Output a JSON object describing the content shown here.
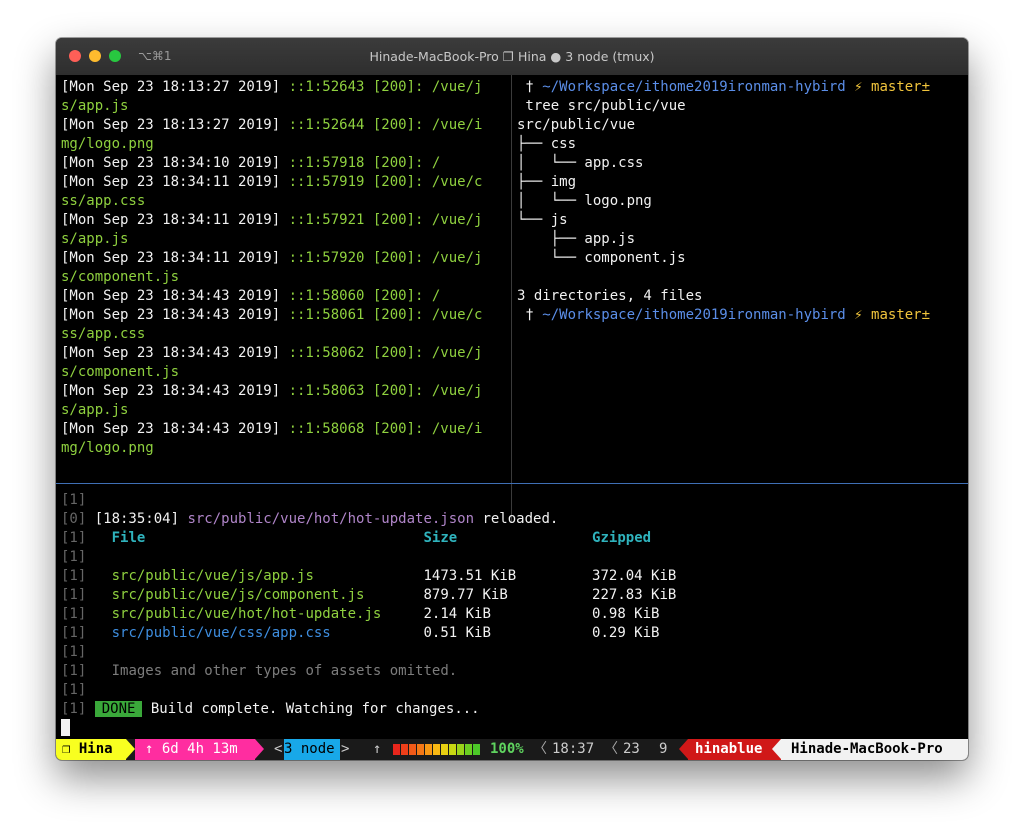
{
  "window": {
    "shortcut": "⌥⌘1",
    "title": "Hinade-MacBook-Pro ❐ Hina ● 3 node (tmux)"
  },
  "left_pane": {
    "lines": [
      [
        [
          "[Mon Sep 23 18:13:27 2019] ",
          "white"
        ],
        [
          "::1:52643 [200]: /vue/j",
          "green"
        ]
      ],
      [
        [
          "s/app.js",
          "green"
        ]
      ],
      [
        [
          "[Mon Sep 23 18:13:27 2019] ",
          "white"
        ],
        [
          "::1:52644 [200]: /vue/i",
          "green"
        ]
      ],
      [
        [
          "mg/logo.png",
          "green"
        ]
      ],
      [
        [
          "[Mon Sep 23 18:34:10 2019] ",
          "white"
        ],
        [
          "::1:57918 [200]: /",
          "green"
        ]
      ],
      [
        [
          "[Mon Sep 23 18:34:11 2019] ",
          "white"
        ],
        [
          "::1:57919 [200]: /vue/c",
          "green"
        ]
      ],
      [
        [
          "ss/app.css",
          "green"
        ]
      ],
      [
        [
          "[Mon Sep 23 18:34:11 2019] ",
          "white"
        ],
        [
          "::1:57921 [200]: /vue/j",
          "green"
        ]
      ],
      [
        [
          "s/app.js",
          "green"
        ]
      ],
      [
        [
          "[Mon Sep 23 18:34:11 2019] ",
          "white"
        ],
        [
          "::1:57920 [200]: /vue/j",
          "green"
        ]
      ],
      [
        [
          "s/component.js",
          "green"
        ]
      ],
      [
        [
          "[Mon Sep 23 18:34:43 2019] ",
          "white"
        ],
        [
          "::1:58060 [200]: /",
          "green"
        ]
      ],
      [
        [
          "[Mon Sep 23 18:34:43 2019] ",
          "white"
        ],
        [
          "::1:58061 [200]: /vue/c",
          "green"
        ]
      ],
      [
        [
          "ss/app.css",
          "green"
        ]
      ],
      [
        [
          "[Mon Sep 23 18:34:43 2019] ",
          "white"
        ],
        [
          "::1:58062 [200]: /vue/j",
          "green"
        ]
      ],
      [
        [
          "s/component.js",
          "green"
        ]
      ],
      [
        [
          "[Mon Sep 23 18:34:43 2019] ",
          "white"
        ],
        [
          "::1:58063 [200]: /vue/j",
          "green"
        ]
      ],
      [
        [
          "s/app.js",
          "green"
        ]
      ],
      [
        [
          "[Mon Sep 23 18:34:43 2019] ",
          "white"
        ],
        [
          "::1:58068 [200]: /vue/i",
          "green"
        ]
      ],
      [
        [
          "mg/logo.png",
          "green"
        ]
      ]
    ]
  },
  "right_pane": {
    "lines": [
      [
        [
          " † ",
          "white"
        ],
        [
          "~/Workspace/ithome2019ironman-hybird ",
          "blue"
        ],
        [
          "⚡ master±",
          "yellow"
        ]
      ],
      [
        [
          " tree src/public/vue",
          "white"
        ]
      ],
      [
        [
          "src/public/vue",
          "white"
        ]
      ],
      [
        [
          "├── css",
          "white"
        ]
      ],
      [
        [
          "│   └── app.css",
          "white"
        ]
      ],
      [
        [
          "├── img",
          "white"
        ]
      ],
      [
        [
          "│   └── logo.png",
          "white"
        ]
      ],
      [
        [
          "└── js",
          "white"
        ]
      ],
      [
        [
          "    ├── app.js",
          "white"
        ]
      ],
      [
        [
          "    └── component.js",
          "white"
        ]
      ],
      [
        [
          "",
          "white"
        ]
      ],
      [
        [
          "3 directories, 4 files",
          "white"
        ]
      ],
      [
        [
          " † ",
          "white"
        ],
        [
          "~/Workspace/ithome2019ironman-hybird ",
          "blue"
        ],
        [
          "⚡ master±",
          "yellow"
        ]
      ]
    ]
  },
  "bottom_pane": {
    "lines": [
      [
        [
          "[1]",
          "gray"
        ]
      ],
      [
        [
          "[0] ",
          "gray"
        ],
        [
          "[18:35:04] ",
          "white"
        ],
        [
          "src/public/vue/hot/hot-update.json",
          "purple"
        ],
        [
          " reloaded.",
          "white"
        ]
      ],
      [
        [
          "[1]",
          "gray"
        ],
        [
          "   ",
          "white"
        ],
        [
          "File                                 ",
          "cyan"
        ],
        [
          "Size                ",
          "cyan"
        ],
        [
          "Gzipped",
          "cyan"
        ]
      ],
      [
        [
          "[1]",
          "gray"
        ]
      ],
      [
        [
          "[1]",
          "gray"
        ],
        [
          "   ",
          "white"
        ],
        [
          "src/public/vue/js/app.js",
          "green"
        ],
        [
          "             1473.51 KiB         372.04 KiB",
          "white"
        ]
      ],
      [
        [
          "[1]",
          "gray"
        ],
        [
          "   ",
          "white"
        ],
        [
          "src/public/vue/js/component.js",
          "green"
        ],
        [
          "       879.77 KiB          227.83 KiB",
          "white"
        ]
      ],
      [
        [
          "[1]",
          "gray"
        ],
        [
          "   ",
          "white"
        ],
        [
          "src/public/vue/hot/hot-update.js",
          "green"
        ],
        [
          "     2.14 KiB            0.98 KiB",
          "white"
        ]
      ],
      [
        [
          "[1]",
          "gray"
        ],
        [
          "   ",
          "white"
        ],
        [
          "src/public/vue/css/app.css",
          "lblue"
        ],
        [
          "           0.51 KiB            0.29 KiB",
          "white"
        ]
      ],
      [
        [
          "[1]",
          "gray"
        ]
      ],
      [
        [
          "[1]",
          "gray"
        ],
        [
          "   ",
          "white"
        ],
        [
          "Images and other types of assets omitted.",
          "dim"
        ]
      ],
      [
        [
          "[1]",
          "gray"
        ]
      ],
      [
        [
          "[1]",
          "gray"
        ],
        [
          " ",
          "white"
        ],
        [
          "DONE",
          "badge"
        ],
        [
          " Build complete. Watching for changes...",
          "white"
        ]
      ]
    ]
  },
  "status_bar": {
    "session": "❐ Hina",
    "uptime": "↑ 6d 4h 13m",
    "window_left": "<",
    "window_label": "3 node",
    "window_right": ">",
    "up_arrow": "↑",
    "battery_percent": "100%",
    "battery_level": 1.0,
    "time": "18:37",
    "day": "23",
    "month": "9",
    "user": "hinablue",
    "hostname": "Hinade-MacBook-Pro",
    "sep_left": "〈",
    "sep_left2": "〈"
  },
  "colors": {
    "session_bg": "#f8ff20",
    "uptime_bg": "#ff2da0",
    "window_bg": "#18a8e8",
    "user_bg": "#d01818",
    "host_bg": "#f2f2f2"
  }
}
